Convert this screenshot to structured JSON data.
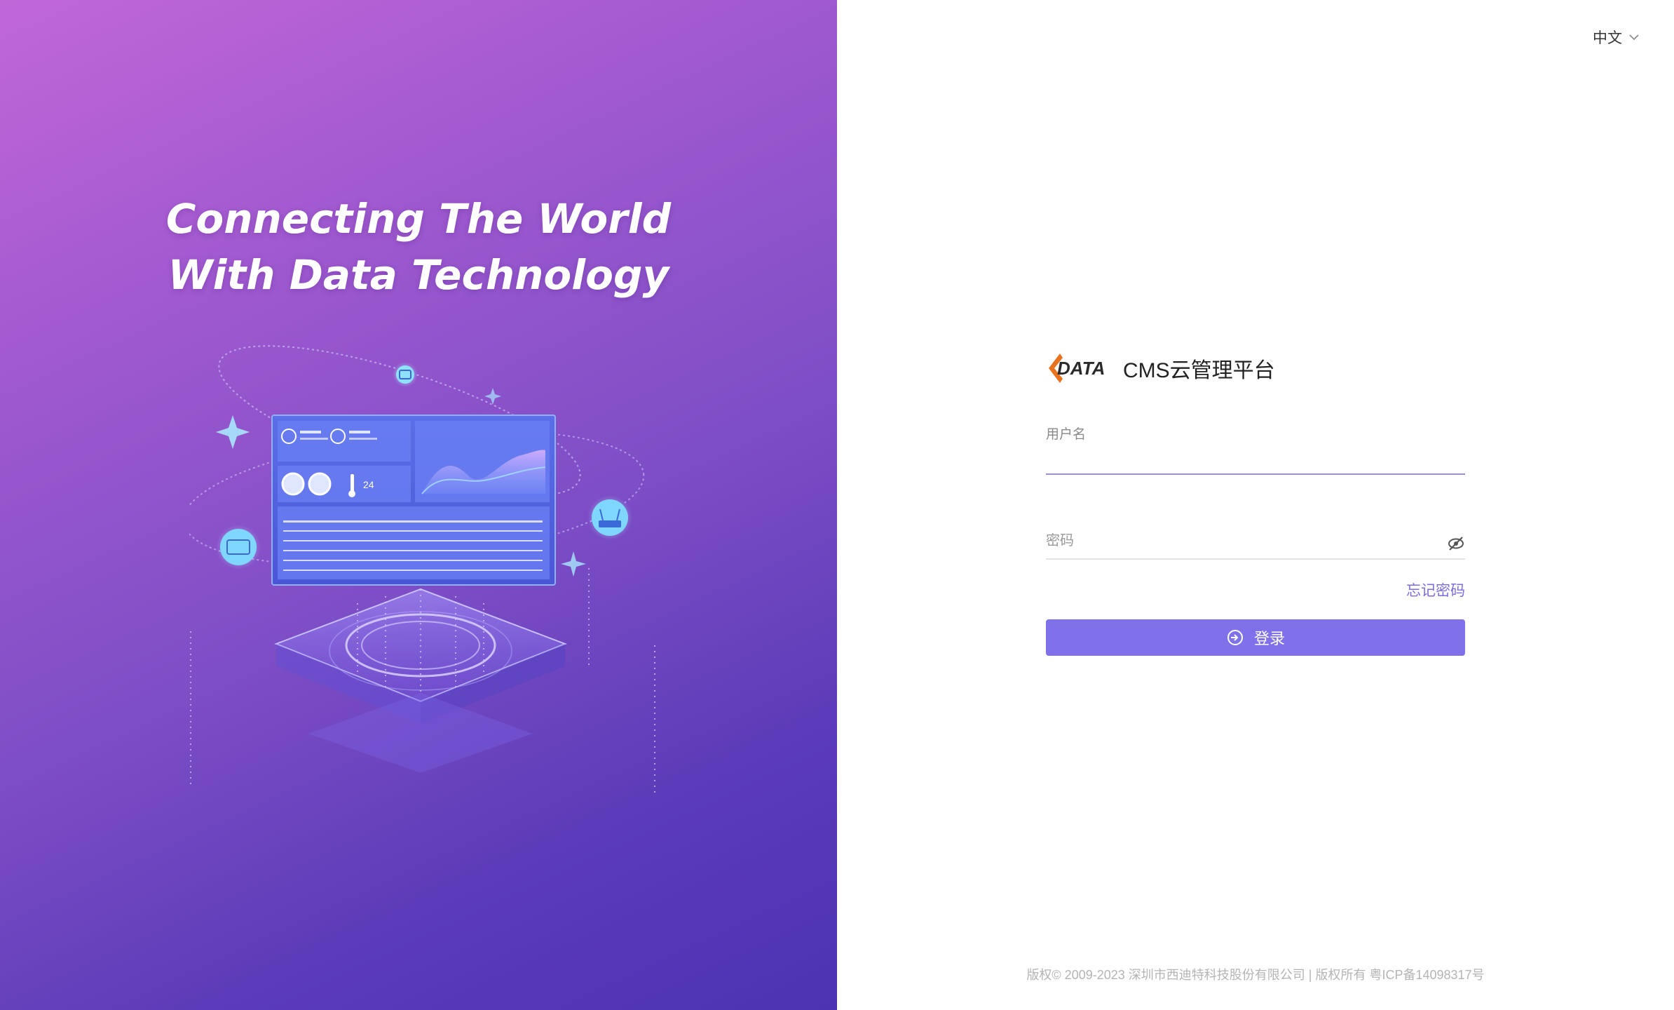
{
  "hero": {
    "headline_line1": "Connecting The World",
    "headline_line2": "With Data Technology",
    "dashboard": {
      "temperature": "24"
    }
  },
  "header": {
    "language_label": "中文",
    "language_icon": "chevron-down-icon"
  },
  "brand": {
    "logo_text": "DATA",
    "title": "CMS云管理平台"
  },
  "form": {
    "username_label": "用户名",
    "username_value": "",
    "password_label": "密码",
    "password_value": "",
    "password_toggle_icon": "eye-off-icon",
    "forgot_password": "忘记密码",
    "login_button": "登录",
    "login_icon": "login-icon"
  },
  "footer": {
    "copyright": "版权© 2009-2023 深圳市西迪特科技股份有限公司 | 版权所有 粤ICP备14098317号"
  },
  "colors": {
    "accent": "#7f71ea",
    "link": "#7a6ee0",
    "hero_start": "#c067d8",
    "hero_end": "#4c33b2",
    "logo_orange": "#e8731e"
  }
}
